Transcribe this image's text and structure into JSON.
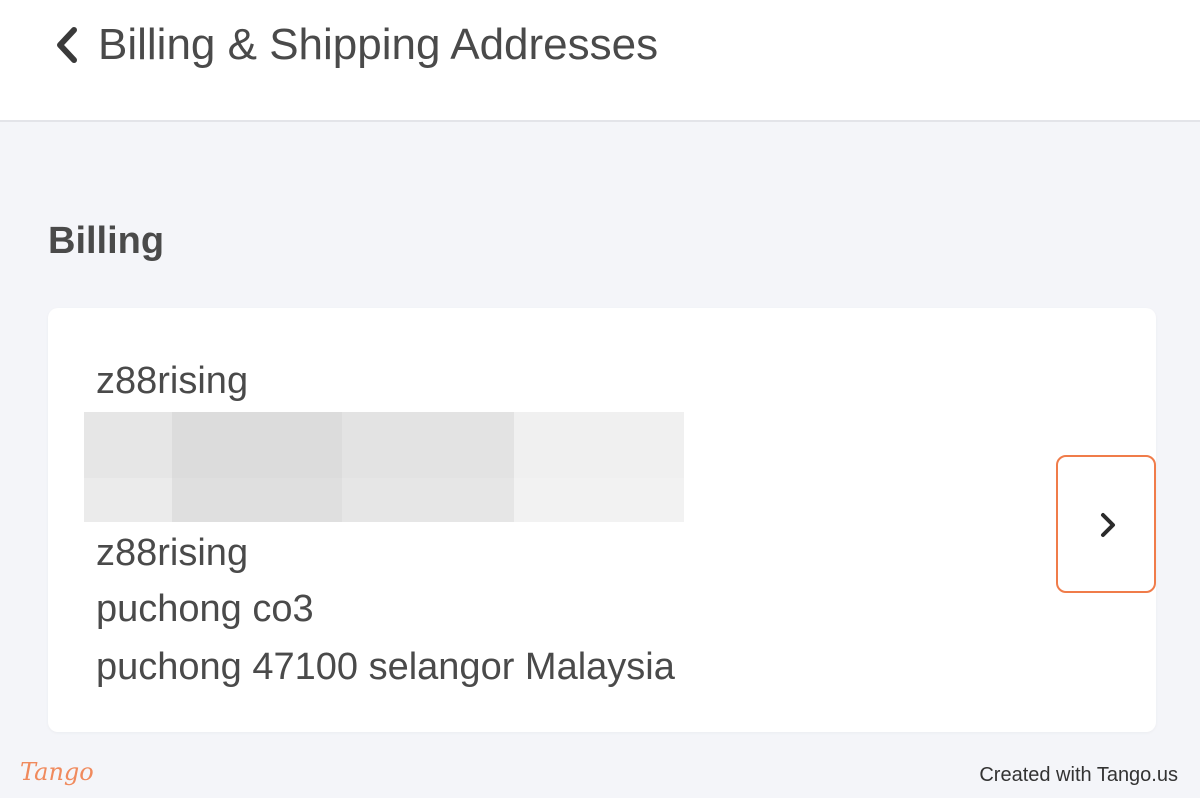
{
  "header": {
    "title": "Billing & Shipping Addresses"
  },
  "billing": {
    "heading": "Billing",
    "card": {
      "name_top": "z88rising",
      "name_bottom": "z88rising",
      "street": "puchong co3",
      "city_line": "puchong 47100 selangor Malaysia"
    }
  },
  "icons": {
    "back": "chevron-left-icon",
    "open_card": "chevron-right-icon"
  },
  "colors": {
    "highlight": "#f07c4a",
    "brand_tango": "#f08a5d"
  },
  "footer": {
    "logo": "Tango",
    "credit": "Created with Tango.us"
  }
}
